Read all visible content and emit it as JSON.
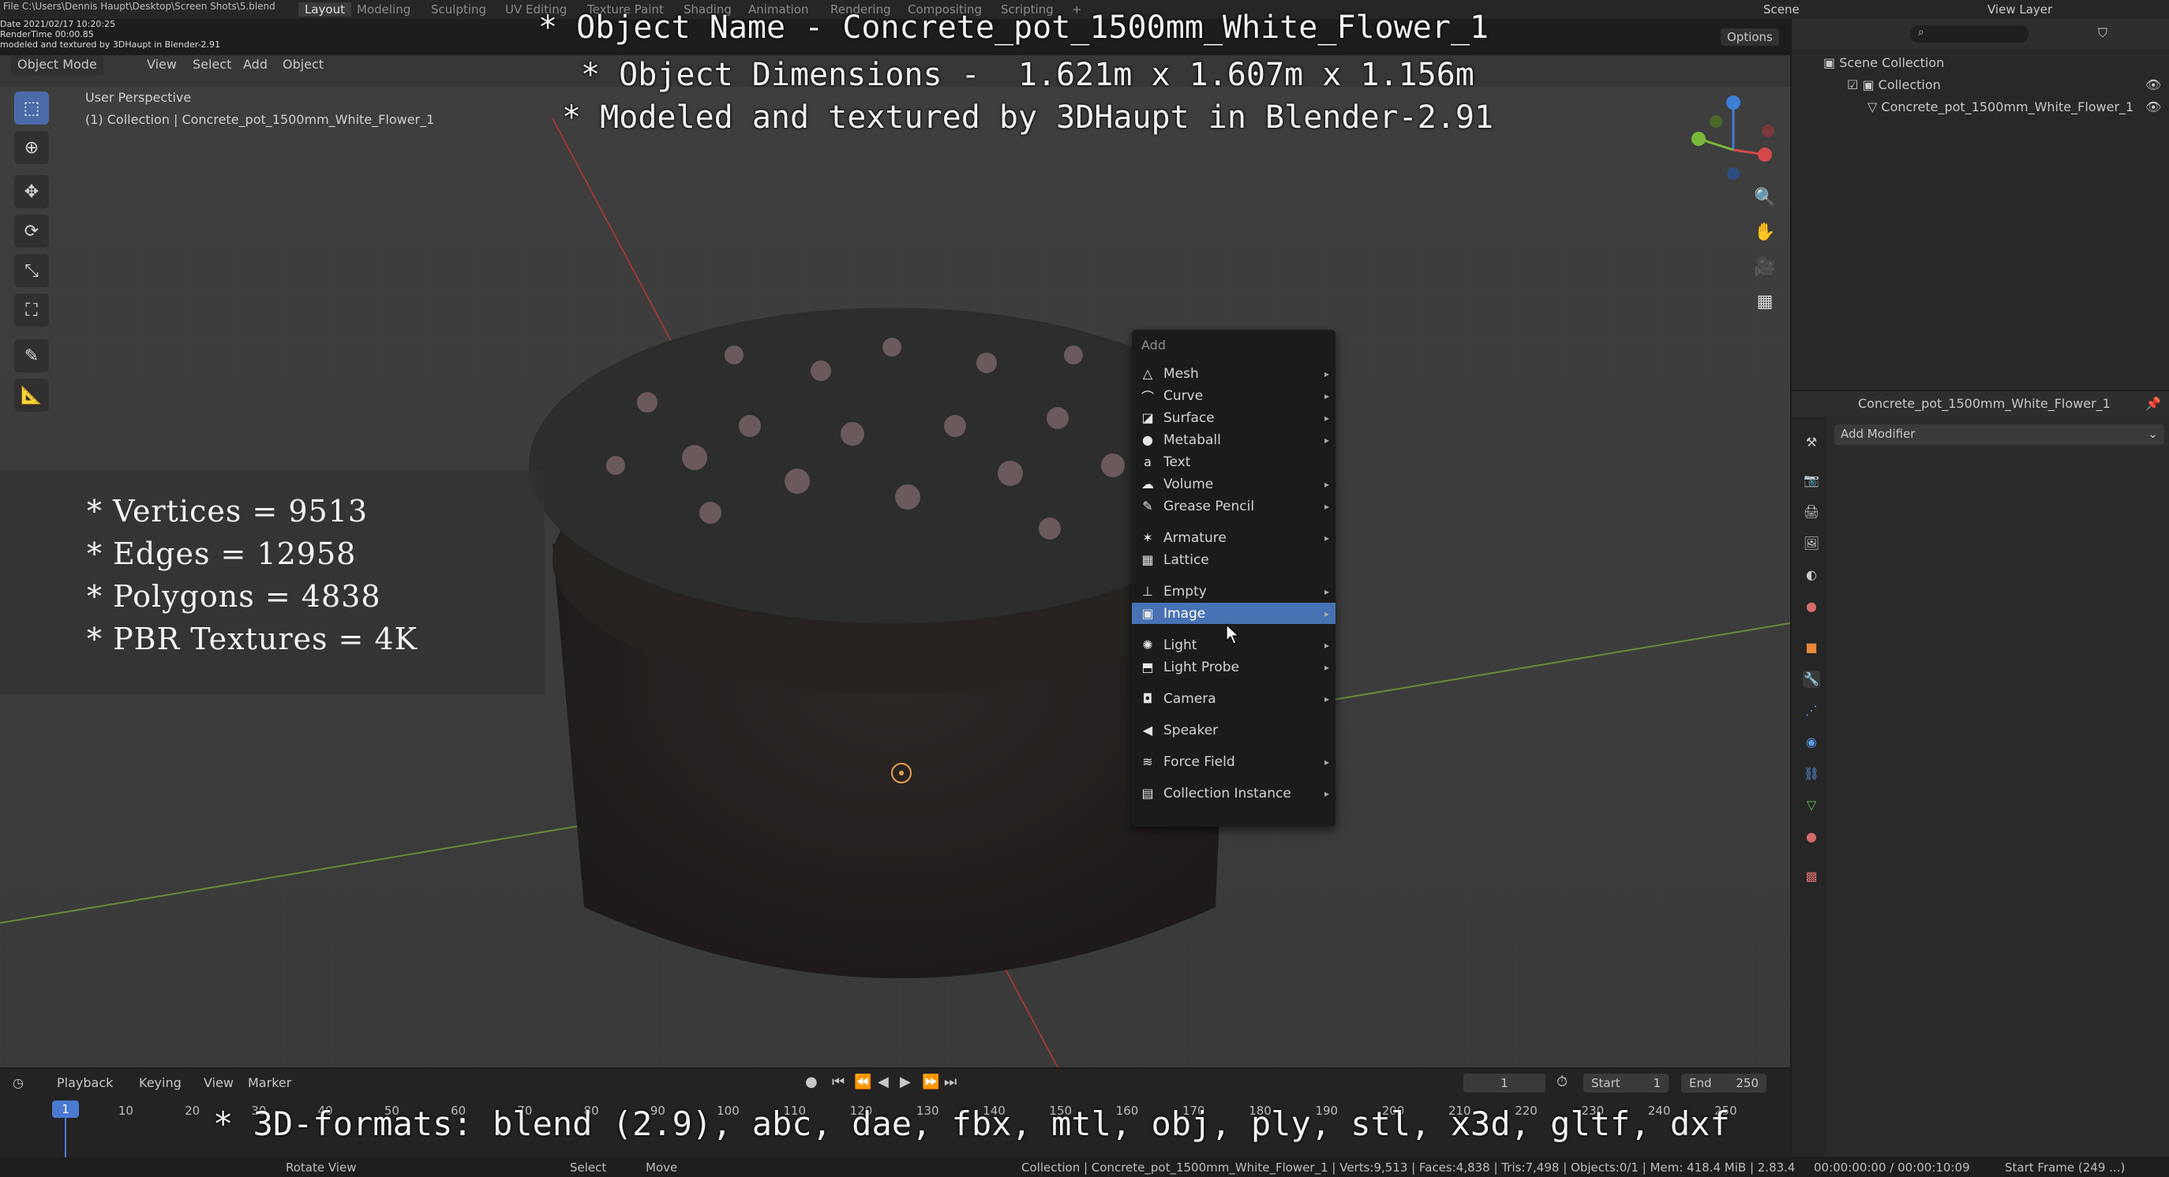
{
  "topbar": {
    "file_path": "File C:\\Users\\Dennis Haupt\\Desktop\\Screen Shots\\5.blend",
    "workspaces": [
      "Layout",
      "Modeling",
      "Sculpting",
      "UV Editing",
      "Texture Paint",
      "Shading",
      "Animation",
      "Rendering",
      "Compositing",
      "Scripting"
    ],
    "add_tab": "+",
    "scene": "Scene",
    "view_layer": "View Layer"
  },
  "render_stamp": {
    "date": "Date 2021/02/17 10:20:25",
    "render_time": "RenderTime 00:00.85",
    "note": "modeled and textured by 3DHaupt in Blender-2.91"
  },
  "header3d": {
    "mode": "Object Mode",
    "menu": [
      "View",
      "Select",
      "Add",
      "Object"
    ],
    "options": "Options"
  },
  "viewport": {
    "perspective": "User Perspective",
    "collection_line": "(1) Collection | Concrete_pot_1500mm_White_Flower_1"
  },
  "overlay": {
    "name": "* Object Name - Concrete_pot_1500mm_White_Flower_1",
    "dims": "* Object Dimensions -  1.621m x 1.607m x 1.156m",
    "credit": "* Modeled and textured by 3DHaupt in Blender-2.91",
    "formats": "* 3D-formats: blend (2.9), abc, dae, fbx, mtl, obj, ply, stl, x3d, gltf, dxf"
  },
  "stats": {
    "vertices": "* Vertices = 9513",
    "edges": "* Edges = 12958",
    "polygons": "* Polygons = 4838",
    "textures": "* PBR Textures = 4K"
  },
  "add_menu": {
    "title": "Add",
    "items": [
      {
        "label": "Mesh",
        "icon": "△",
        "submenu": true
      },
      {
        "label": "Curve",
        "icon": "⌒",
        "submenu": true
      },
      {
        "label": "Surface",
        "icon": "◪",
        "submenu": true
      },
      {
        "label": "Metaball",
        "icon": "●",
        "submenu": true
      },
      {
        "label": "Text",
        "icon": "a",
        "submenu": false
      },
      {
        "label": "Volume",
        "icon": "☁",
        "submenu": true
      },
      {
        "label": "Grease Pencil",
        "icon": "✎",
        "submenu": true
      },
      {
        "label": "Armature",
        "icon": "✶",
        "submenu": true
      },
      {
        "label": "Lattice",
        "icon": "▦",
        "submenu": false
      },
      {
        "label": "Empty",
        "icon": "⊥",
        "submenu": true
      },
      {
        "label": "Image",
        "icon": "▣",
        "submenu": true,
        "highlighted": true
      },
      {
        "label": "Light",
        "icon": "✺",
        "submenu": true
      },
      {
        "label": "Light Probe",
        "icon": "⬒",
        "submenu": true
      },
      {
        "label": "Camera",
        "icon": "◘",
        "submenu": true
      },
      {
        "label": "Speaker",
        "icon": "◀",
        "submenu": false
      },
      {
        "label": "Force Field",
        "icon": "≋",
        "submenu": true
      },
      {
        "label": "Collection Instance",
        "icon": "▤",
        "submenu": true
      }
    ]
  },
  "outliner": {
    "root": "Scene Collection",
    "collection": "Collection",
    "object": "Concrete_pot_1500mm_White_Flower_1"
  },
  "properties": {
    "object_name": "Concrete_pot_1500mm_White_Flower_1",
    "add_modifier": "Add Modifier"
  },
  "timeline": {
    "menus": [
      "Playback",
      "Keying",
      "View",
      "Marker"
    ],
    "current_frame": "1",
    "start_label": "Start",
    "start": "1",
    "end_label": "End",
    "end": "250",
    "ticks": [
      "1",
      "10",
      "20",
      "30",
      "40",
      "50",
      "60",
      "70",
      "80",
      "90",
      "100",
      "110",
      "120",
      "130",
      "140",
      "150",
      "160",
      "170",
      "180",
      "190",
      "200",
      "210",
      "220",
      "230",
      "240",
      "250"
    ]
  },
  "statusbar": {
    "left": "Rotate View",
    "select": "Select",
    "move": "Move",
    "info": "Collection | Concrete_pot_1500mm_White_Flower_1 | Verts:9,513 | Faces:4,838 | Tris:7,498 | Objects:0/1 | Mem: 418.4 MiB | 2.83.4",
    "time": "00:00:00:00 / 00:00:10:09",
    "start_frame": "Start Frame (249 ...)"
  }
}
